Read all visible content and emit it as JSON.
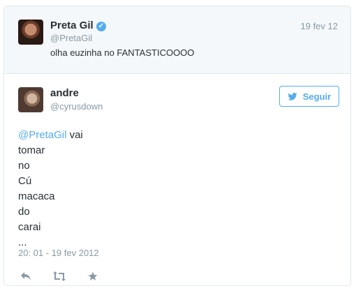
{
  "quoted_tweet": {
    "author_name": "Preta Gil",
    "author_handle": "@PretaGil",
    "date": "19 fev 12",
    "text": "olha euzinha no FANTASTICOOOO"
  },
  "main_tweet": {
    "author_name": "andre",
    "author_handle": "@cyrusdown",
    "follow_label": "Seguir",
    "mention": "@PretaGil",
    "lines": [
      "vai",
      "tomar",
      "no",
      "Cú",
      "macaca",
      "do",
      "carai",
      "..."
    ],
    "timestamp": "20: 01 - 19 fev 2012"
  },
  "icons": {
    "verified": "verified-badge-icon",
    "bird": "twitter-bird-icon",
    "reply": "reply-icon",
    "retweet": "retweet-icon",
    "favorite": "star-icon"
  },
  "colors": {
    "accent": "#55acee",
    "muted": "#8899a6",
    "text": "#292f33",
    "quoted_bg": "#f5f8fa",
    "border": "#e1e8ed"
  }
}
